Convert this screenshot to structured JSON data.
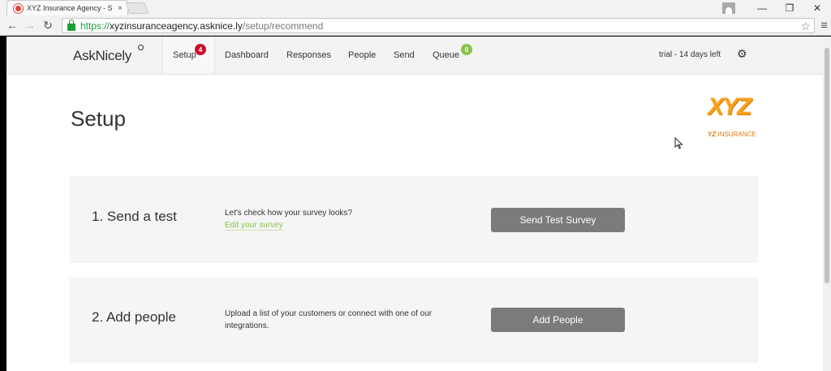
{
  "browser": {
    "tab_title": "XYZ Insurance Agency - S",
    "tab_close": "×",
    "url_scheme": "https://",
    "url_host": "xyzinsuranceagency.asknice.ly",
    "url_path": "/setup/recommend",
    "window_controls": {
      "minimize": "—",
      "restore": "❐",
      "close": "✕"
    }
  },
  "app": {
    "logo": "AskNicely",
    "nav": [
      {
        "label": "Setup",
        "badge": "4"
      },
      {
        "label": "Dashboard"
      },
      {
        "label": "Responses"
      },
      {
        "label": "People"
      },
      {
        "label": "Send"
      },
      {
        "label": "Queue",
        "badge": "0"
      }
    ],
    "trial": "trial - 14 days left",
    "settings_icon": "gear-icon"
  },
  "page": {
    "title": "Setup",
    "company_logo": {
      "main": "XYZ",
      "sub_bold": "YZ",
      "sub": "INSURANCE"
    },
    "cards": [
      {
        "title": "1. Send a test",
        "description": "Let's check how your survey looks?",
        "link": "Edit your survey",
        "button": "Send Test Survey"
      },
      {
        "title": "2. Add people",
        "description": "Upload a list of your customers or connect with one of our integrations.",
        "button": "Add People"
      }
    ]
  },
  "colors": {
    "badge_red": "#c8102e",
    "badge_green": "#8bc34a",
    "link_green": "#8bc34a",
    "button_gray": "#7b7b7b",
    "logo_orange": "#f6a21a"
  }
}
